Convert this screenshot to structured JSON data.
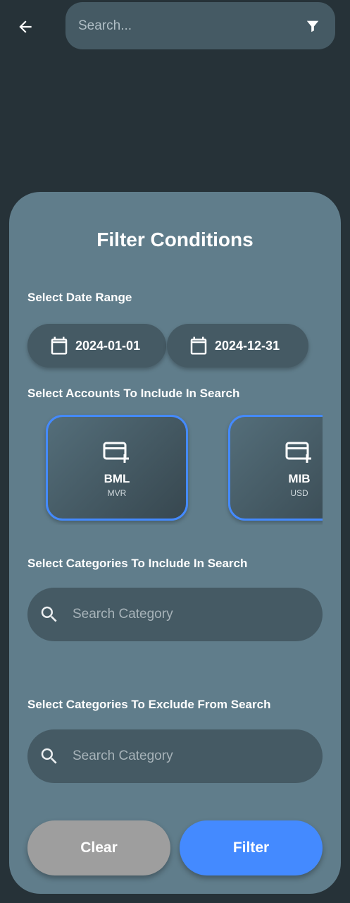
{
  "topbar": {
    "search_placeholder": "Search..."
  },
  "sheet": {
    "title": "Filter Conditions",
    "date_range": {
      "label": "Select Date Range",
      "start": "2024-01-01",
      "end": "2024-12-31"
    },
    "accounts": {
      "label": "Select Accounts To Include In Search",
      "items": [
        {
          "name": "BML",
          "currency": "MVR",
          "selected": true
        },
        {
          "name": "MIB",
          "currency": "USD",
          "selected": true
        }
      ]
    },
    "include_categories": {
      "label": "Select Categories To Include In Search",
      "placeholder": "Search Category"
    },
    "exclude_categories": {
      "label": "Select Categories To Exclude From Search",
      "placeholder": "Search Category"
    },
    "buttons": {
      "clear": "Clear",
      "filter": "Filter"
    }
  },
  "colors": {
    "background": "#263238",
    "sheet": "#607d8b",
    "field": "#455a64",
    "accent": "#448aff",
    "clear_button": "#9e9e9e"
  },
  "icons": [
    "back-arrow-icon",
    "filter-funnel-icon",
    "calendar-icon",
    "card-add-icon",
    "search-icon"
  ]
}
